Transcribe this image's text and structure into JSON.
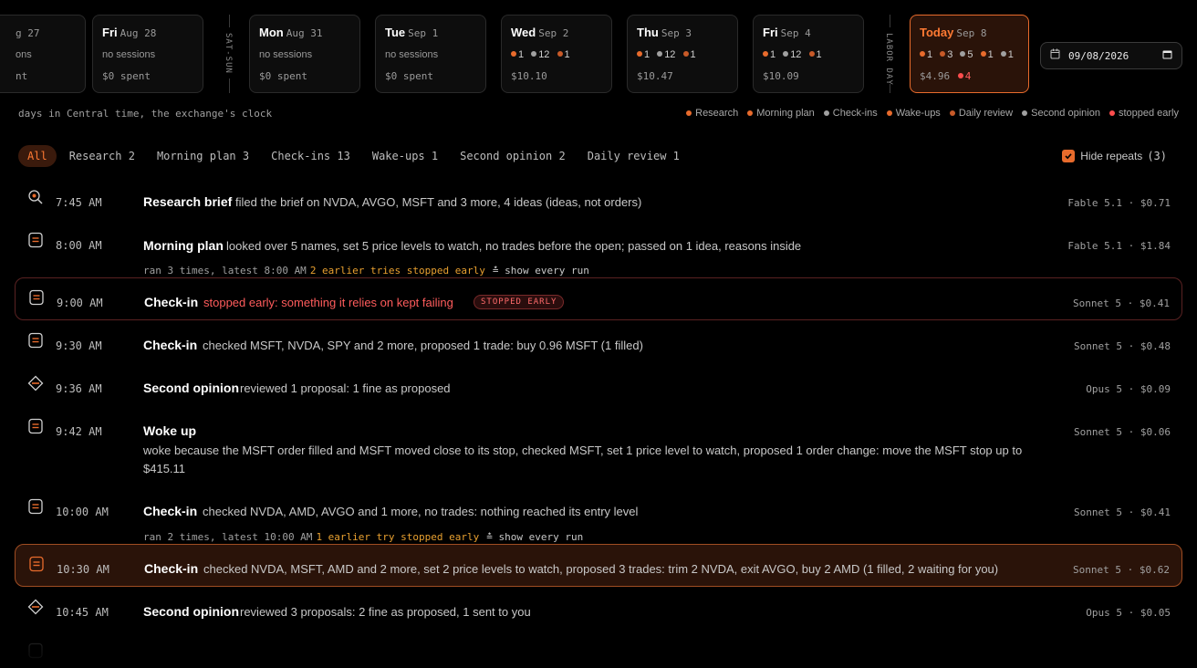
{
  "days": [
    {
      "name": "",
      "date": "g 27",
      "line2": "ons",
      "line3": "nt",
      "type": "partial"
    },
    {
      "name": "Fri",
      "date": "Aug 28",
      "line2": "no sessions",
      "line3": "$0 spent"
    },
    {
      "name": "Mon",
      "date": "Aug 31",
      "line2": "no sessions",
      "line3": "$0 spent"
    },
    {
      "name": "Tue",
      "date": "Sep 1",
      "line2": "no sessions",
      "line3": "$0 spent"
    },
    {
      "name": "Wed",
      "date": "Sep 2",
      "counts": [
        "1",
        "12",
        "1"
      ],
      "line3": "$10.10"
    },
    {
      "name": "Thu",
      "date": "Sep 3",
      "counts": [
        "1",
        "12",
        "1"
      ],
      "line3": "$10.47"
    },
    {
      "name": "Fri",
      "date": "Sep 4",
      "counts": [
        "1",
        "12",
        "1"
      ],
      "line3": "$10.09"
    },
    {
      "name": "Today",
      "date": "Sep 8",
      "counts": [
        "1",
        "3",
        "5",
        "1",
        "1"
      ],
      "line3": "$4.96",
      "failed": "4"
    }
  ],
  "dividers": {
    "weekend": "SAT-SUN",
    "holiday": "LABOR DAY"
  },
  "date_picker": {
    "value": "09/08/2026"
  },
  "timezone_note": "days in Central time, the exchange's clock",
  "legend": [
    "Research",
    "Morning plan",
    "Check-ins",
    "Wake-ups",
    "Daily review",
    "Second opinion",
    "stopped early"
  ],
  "colors": {
    "accent": "#e86b2c",
    "gray": "#a0a0a0",
    "red": "#ff4d4d",
    "highlight_bg": "#2a1309"
  },
  "tabs": [
    {
      "label": "All",
      "count": ""
    },
    {
      "label": "Research",
      "count": "2"
    },
    {
      "label": "Morning plan",
      "count": "3"
    },
    {
      "label": "Check-ins",
      "count": "13"
    },
    {
      "label": "Wake-ups",
      "count": "1"
    },
    {
      "label": "Second opinion",
      "count": "2"
    },
    {
      "label": "Daily review",
      "count": "1"
    }
  ],
  "hide_repeats": {
    "label": "Hide repeats",
    "count": "(3)"
  },
  "rows": [
    {
      "icon": "search-icon",
      "time": "7:45 AM",
      "title": "Research brief",
      "desc": "filed the brief on NVDA, AVGO, MSFT and 3 more, 4 ideas (ideas, not orders)",
      "meta": "Fable 5.1 · $0.71"
    },
    {
      "icon": "doc-icon",
      "time": "8:00 AM",
      "title": "Morning plan",
      "desc": "looked over 5 names, set 5 price levels to watch, no trades before the open; passed on 1 idea, reasons inside",
      "meta": "Fable 5.1 · $1.84",
      "sub": {
        "text": "ran 3 times, latest 8:00 AM",
        "warn": "2 earlier tries stopped early",
        "show": "show every run"
      }
    },
    {
      "icon": "doc-icon",
      "time": "9:00 AM",
      "title": "Check-in",
      "desc": "stopped early: something it relies on kept failing",
      "badge": "STOPPED EARLY",
      "meta": "Sonnet 5 · $0.41"
    },
    {
      "icon": "doc-icon",
      "time": "9:30 AM",
      "title": "Check-in",
      "desc": "checked MSFT, NVDA, SPY and 2 more, proposed 1 trade: buy 0.96 MSFT (1 filled)",
      "meta": "Sonnet 5 · $0.48"
    },
    {
      "icon": "diamond-icon",
      "time": "9:36 AM",
      "title": "Second opinion",
      "desc": "reviewed 1 proposal: 1 fine as proposed",
      "meta": "Opus 5 · $0.09"
    },
    {
      "icon": "doc-icon",
      "time": "9:42 AM",
      "title": "Woke up",
      "desc": "woke because the MSFT order filled and MSFT moved close to its stop, checked MSFT, set 1 price level to watch, proposed 1 order change: move the MSFT stop up to $415.11",
      "meta": "Sonnet 5 · $0.06"
    },
    {
      "icon": "doc-icon",
      "time": "10:00 AM",
      "title": "Check-in",
      "desc": "checked NVDA, AMD, AVGO and 1 more, no trades: nothing reached its entry level",
      "meta": "Sonnet 5 · $0.41",
      "sub": {
        "text": "ran 2 times, latest 10:00 AM",
        "warn": "1 earlier try stopped early",
        "show": "show every run"
      }
    },
    {
      "icon": "doc-icon",
      "time": "10:30 AM",
      "title": "Check-in",
      "desc": "checked NVDA, MSFT, AMD and 2 more, set 2 price levels to watch, proposed 3 trades: trim 2 NVDA, exit AVGO, buy 2 AMD (1 filled, 2 waiting for you)",
      "meta": "Sonnet 5 · $0.62"
    },
    {
      "icon": "diamond-icon",
      "time": "10:45 AM",
      "title": "Second opinion",
      "desc": "reviewed 3 proposals: 2 fine as proposed, 1 sent to you",
      "meta": "Opus 5 · $0.05"
    }
  ]
}
